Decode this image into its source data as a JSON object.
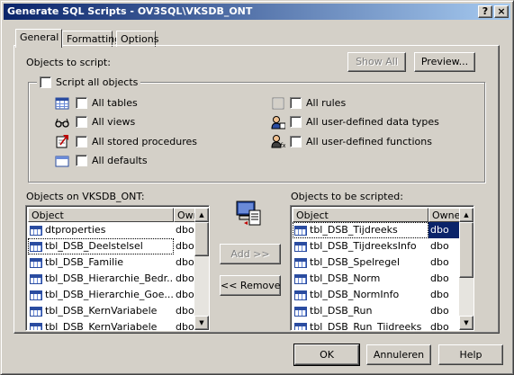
{
  "window": {
    "title": "Generate SQL Scripts - OV3SQL\\VKSDB_ONT",
    "help_glyph": "?",
    "close_glyph": "×"
  },
  "tabs": [
    {
      "label": "General",
      "active": true
    },
    {
      "label": "Formatting",
      "active": false
    },
    {
      "label": "Options",
      "active": false
    }
  ],
  "general": {
    "objects_to_script_label": "Objects to script:",
    "show_all_label": "Show All",
    "preview_label": "Preview...",
    "script_all_objects_label": "Script all objects",
    "options": {
      "all_tables": "All tables",
      "all_views": "All views",
      "all_stored_procedures": "All stored procedures",
      "all_defaults": "All defaults",
      "all_rules": "All rules",
      "all_user_defined_data_types": "All user-defined data types",
      "all_user_defined_functions": "All user-defined functions"
    },
    "objects_on_label": "Objects on VKSDB_ONT:",
    "objects_to_be_scripted_label": "Objects to be scripted:",
    "add_label": "Add >>",
    "remove_label": "<< Remove",
    "left_list": {
      "col_object": "Object",
      "col_owner": "Owr",
      "rows": [
        {
          "name": "dtproperties",
          "owner": "dbo"
        },
        {
          "name": "tbl_DSB_Deelstelsel",
          "owner": "dbo"
        },
        {
          "name": "tbl_DSB_Familie",
          "owner": "dbo"
        },
        {
          "name": "tbl_DSB_Hierarchie_Bedr...",
          "owner": "dbo"
        },
        {
          "name": "tbl_DSB_Hierarchie_Goe...",
          "owner": "dbo"
        },
        {
          "name": "tbl_DSB_KernVariabele",
          "owner": "dbo"
        },
        {
          "name": "tbl_DSB_KernVariabele",
          "owner": "dbo"
        }
      ]
    },
    "right_list": {
      "col_object": "Object",
      "col_owner": "Owne",
      "rows": [
        {
          "name": "tbl_DSB_Tijdreeks",
          "owner": "dbo"
        },
        {
          "name": "tbl_DSB_TijdreeksInfo",
          "owner": "dbo"
        },
        {
          "name": "tbl_DSB_Spelregel",
          "owner": "dbo"
        },
        {
          "name": "tbl_DSB_Norm",
          "owner": "dbo"
        },
        {
          "name": "tbl_DSB_NormInfo",
          "owner": "dbo"
        },
        {
          "name": "tbl_DSB_Run",
          "owner": "dbo"
        },
        {
          "name": "tbl_DSB_Run_Tijdreeks",
          "owner": "dbo"
        }
      ]
    }
  },
  "footer": {
    "ok_label": "OK",
    "cancel_label": "Annuleren",
    "help_label": "Help"
  }
}
